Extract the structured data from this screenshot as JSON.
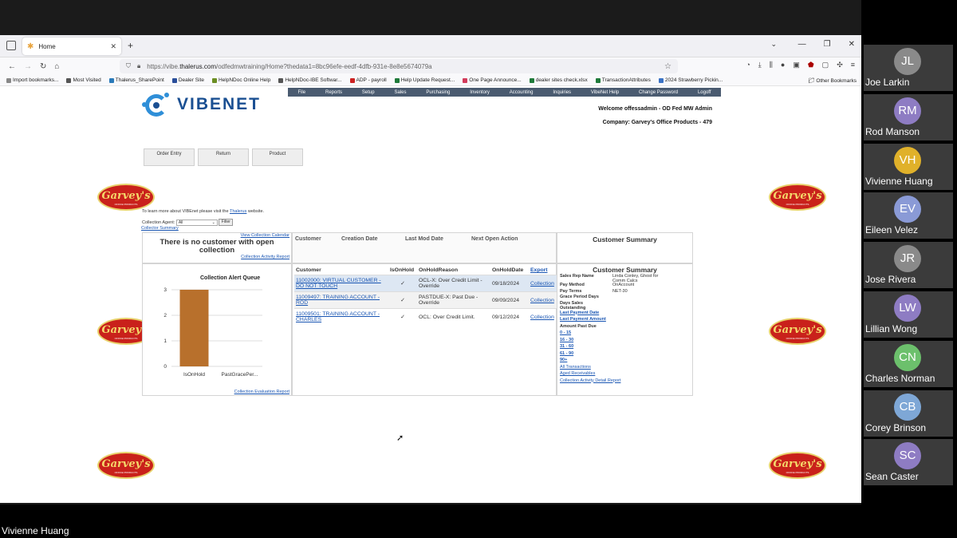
{
  "browser": {
    "tab_title": "Home",
    "url_prefix": "https://vibe.",
    "url_host": "thalerus.com",
    "url_path": "/odfedmwtraining/Home?thedata1=8bc96efe-eedf-4dfb-931e-8e8e5674079a",
    "bookmarks": [
      {
        "label": "Import bookmarks...",
        "color": "#888888"
      },
      {
        "label": "Most Visited",
        "color": "#555555"
      },
      {
        "label": "Thalerus_SharePoint",
        "color": "#2a7ab9"
      },
      {
        "label": "Dealer Site",
        "color": "#2a4e9a"
      },
      {
        "label": "HelpNDoc Online Help",
        "color": "#6b8e23"
      },
      {
        "label": "HelpNDoc-IBE Softwar...",
        "color": "#555555"
      },
      {
        "label": "ADP - payroll",
        "color": "#cc2222"
      },
      {
        "label": "Help Update Request...",
        "color": "#1f7a3a"
      },
      {
        "label": "One Page Announce...",
        "color": "#d23b5a"
      },
      {
        "label": "dealer sites check.xlsx",
        "color": "#1f7a3a"
      },
      {
        "label": "TransactionAttributes",
        "color": "#1f7a3a"
      },
      {
        "label": "2024 Strawberry Pickin...",
        "color": "#3a72c4"
      }
    ],
    "other_bookmarks": "Other Bookmarks"
  },
  "app": {
    "logo_text": "VIBENET",
    "menu": [
      "File",
      "Reports",
      "Setup",
      "Sales",
      "Purchasing",
      "Inventory",
      "Accounting",
      "Inquiries",
      "VibeNet Help",
      "Change Password",
      "Logoff"
    ],
    "welcome": "Welcome offessadmin - OD Fed MW Admin",
    "company": "Company: Garvey's Office Products - 479",
    "brand_badge": "Garvey's",
    "brand_sub": "OFFICE PRODUCTS",
    "quick_buttons": [
      "Order Entry",
      "Return",
      "Product"
    ],
    "learn_more_prefix": "To learn more about VIBEnet please visit the ",
    "learn_more_link": "Thalerus",
    "learn_more_suffix": " website.",
    "collection_agent_label": "Collection Agent:",
    "collection_agent_value": "All",
    "filter_label": "Filter",
    "collector_summary": "Collector Summary",
    "view_collection_calendar": "View Collection Calendar",
    "no_customer_msg": "There is no customer with open collection",
    "collection_activity_report": "Collection Activity Report",
    "collection_evaluation_report": "Collection Evaluation Report",
    "top_columns": [
      "Customer",
      "Creation Date",
      "Last Mod Date",
      "Next Open Action"
    ],
    "customer_summary_title": "Customer Summary"
  },
  "chart_data": {
    "type": "bar",
    "title": "Collection Alert Queue",
    "categories": [
      "IsOnHold",
      "PastGracePer..."
    ],
    "values": [
      3,
      0
    ],
    "yticks": [
      "0",
      "1",
      "2",
      "3"
    ],
    "ylim": [
      0,
      3
    ],
    "bar_color": "#b8702c",
    "grid": true
  },
  "queue": {
    "headers": [
      "Customer",
      "IsOnHold",
      "OnHoldReason",
      "OnHoldDate",
      "Export"
    ],
    "rows": [
      {
        "customer": "11002000: VIRTUAL CUSTOMER - DO NOT TOUCH",
        "onhold": "✓",
        "reason": "OCL-X: Over Credit Limit - Override",
        "date": "09/18/2024",
        "action": "Collection"
      },
      {
        "customer": "11009497: TRAINING ACCOUNT - ROD",
        "onhold": "✓",
        "reason": "PASTDUE-X: Past Due - Override",
        "date": "09/09/2024",
        "action": "Collection"
      },
      {
        "customer": "11009501: TRAINING ACCOUNT - CHARLES",
        "onhold": "✓",
        "reason": "OCL: Over Credit Limit.",
        "date": "09/12/2024",
        "action": "Collection"
      }
    ]
  },
  "customer_summary": {
    "fields": [
      {
        "k": "Sales Rep Name",
        "v": "Linda Conley, Ghost for Comm Calcs"
      },
      {
        "k": "Pay Method",
        "v": "OnAccount"
      },
      {
        "k": "Pay Terms",
        "v": "NET-30"
      },
      {
        "k": "Grace Period Days",
        "v": ""
      },
      {
        "k": "Days Sales Outstanding",
        "v": ""
      }
    ],
    "bold_links": [
      "Last Payment Date",
      "Last Payment Amount"
    ],
    "amount_past_due": "Amount Past Due",
    "aging_links": [
      "0 - 15",
      "16 - 30",
      "31 - 60",
      "61 - 90",
      "90+"
    ],
    "bottom_links": [
      "All Transactions",
      "Aged Receivables",
      "Collection Activity Detail Report"
    ]
  },
  "participants": [
    {
      "initials": "JL",
      "name": "Joe Larkin",
      "color": "#8a8a8a"
    },
    {
      "initials": "RM",
      "name": "Rod Manson",
      "color": "#8e7cc3"
    },
    {
      "initials": "VH",
      "name": "Vivienne Huang",
      "color": "#e0b12a"
    },
    {
      "initials": "EV",
      "name": "Eileen Velez",
      "color": "#8a9ad6"
    },
    {
      "initials": "JR",
      "name": "Jose Rivera",
      "color": "#8a8a8a"
    },
    {
      "initials": "LW",
      "name": "Lillian Wong",
      "color": "#8e7cc3"
    },
    {
      "initials": "CN",
      "name": "Charles Norman",
      "color": "#6cc06c"
    },
    {
      "initials": "CB",
      "name": "Corey Brinson",
      "color": "#7ea7d6"
    },
    {
      "initials": "SC",
      "name": "Sean Caster",
      "color": "#8e7cc3"
    }
  ],
  "presenter_name": "Vivienne Huang"
}
